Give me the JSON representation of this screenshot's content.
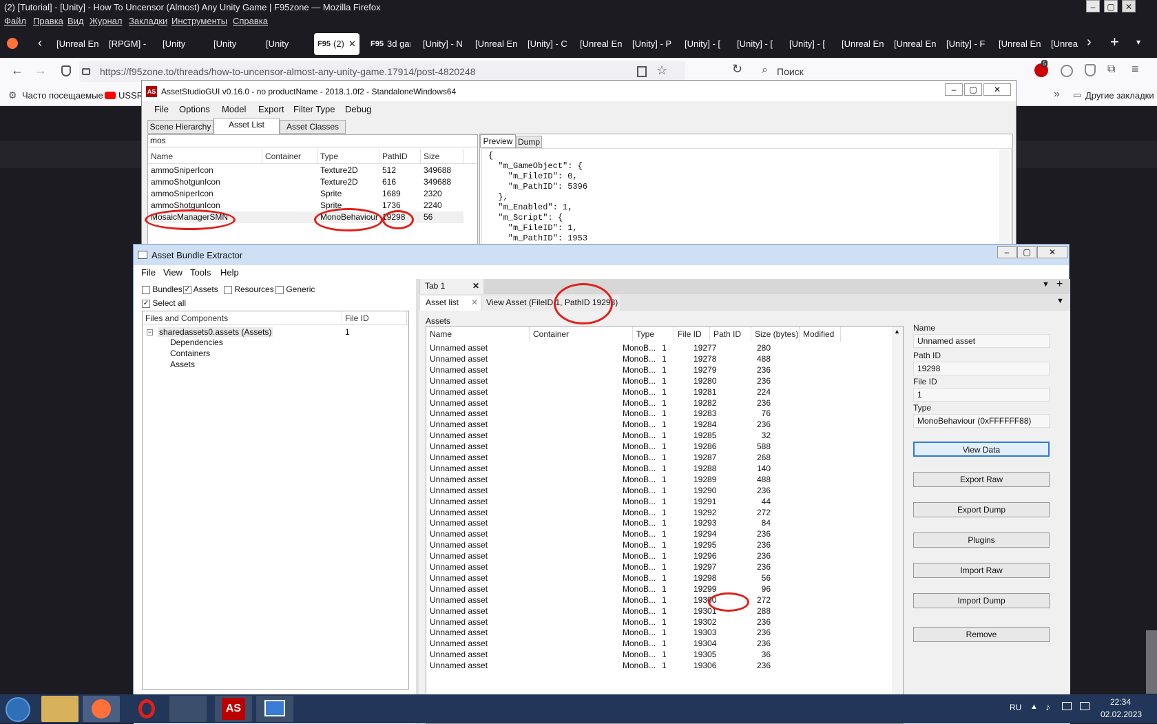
{
  "firefox": {
    "window_title": "(2) [Tutorial] - [Unity] - How To Uncensor (Almost) Any Unity Game | F95zone — Mozilla Firefox",
    "menu": [
      "Файл",
      "Правка",
      "Вид",
      "Журнал",
      "Закладки",
      "Инструменты",
      "Справка"
    ],
    "tabs": [
      "[Unreal En",
      "[RPGM] -",
      "[Unity",
      "[Unity",
      "[Unity",
      "(2)",
      "3d gar",
      "[Unity] - N",
      "[Unreal En",
      "[Unity] - C",
      "[Unreal En",
      "[Unity] - P",
      "[Unity] - [",
      "[Unity] - [",
      "[Unity] - [",
      "[Unreal En",
      "[Unreal En",
      "[Unity] - F",
      "[Unreal En",
      "[Unrea"
    ],
    "url": "https://f95zone.to/threads/how-to-uncensor-almost-any-unity-game.17914/post-4820248",
    "search_placeholder": "Поиск",
    "bookmarks": [
      "Часто посещаемые",
      "USSR"
    ],
    "other_bookmarks": "Другие закладки",
    "badge": "5",
    "window_controls": [
      "–",
      "▢",
      "✕"
    ],
    "tab_logo": "F95"
  },
  "assetstudio": {
    "title": "AssetStudioGUI v0.16.0 - no productName - 2018.1.0f2 - StandaloneWindows64",
    "logo": "AS",
    "menu": [
      "File",
      "Options",
      "Model",
      "Export",
      "Filter Type",
      "Debug"
    ],
    "tabs": [
      "Scene Hierarchy",
      "Asset List",
      "Asset Classes"
    ],
    "filter_text": "mos",
    "columns": [
      "Name",
      "Container",
      "Type",
      "PathID",
      "Size"
    ],
    "rows": [
      [
        "ammoSniperIcon",
        "",
        "Texture2D",
        "512",
        "349688"
      ],
      [
        "ammoShotgunIcon",
        "",
        "Texture2D",
        "616",
        "349688"
      ],
      [
        "ammoSniperIcon",
        "",
        "Sprite",
        "1689",
        "2320"
      ],
      [
        "ammoShotgunIcon",
        "",
        "Sprite",
        "1736",
        "2240"
      ],
      [
        "MosaicManagerSMN",
        "",
        "MonoBehaviour",
        "19298",
        "56"
      ]
    ],
    "preview_tabs": [
      "Preview",
      "Dump"
    ],
    "preview_json": "{\n  \"m_GameObject\": {\n    \"m_FileID\": 0,\n    \"m_PathID\": 5396\n  },\n  \"m_Enabled\": 1,\n  \"m_Script\": {\n    \"m_FileID\": 1,\n    \"m_PathID\": 1953\n  },"
  },
  "abe": {
    "title": "Asset Bundle Extractor",
    "menu": [
      "File",
      "View",
      "Tools",
      "Help"
    ],
    "filters": [
      {
        "label": "Bundles",
        "checked": false
      },
      {
        "label": "Assets",
        "checked": true
      },
      {
        "label": "Resources",
        "checked": false
      },
      {
        "label": "Generic",
        "checked": false
      }
    ],
    "select_all": "Select all",
    "tree_columns": [
      "Files and Components",
      "File ID"
    ],
    "tree": {
      "root": "sharedassets0.assets (Assets)",
      "root_id": "1",
      "children": [
        "Dependencies",
        "Containers",
        "Assets"
      ]
    },
    "doc_tab": "Tab 1",
    "sub_tabs": [
      "Asset list",
      "View Asset (FileID 1, PathID 19298)"
    ],
    "assets_label": "Assets",
    "grid_columns": [
      "Name",
      "Container",
      "Type",
      "File ID",
      "Path ID",
      "Size (bytes)",
      "Modified"
    ],
    "grid_rows": [
      [
        "Unnamed asset",
        "MonoB...",
        "1",
        "19277",
        "280"
      ],
      [
        "Unnamed asset",
        "MonoB...",
        "1",
        "19278",
        "488"
      ],
      [
        "Unnamed asset",
        "MonoB...",
        "1",
        "19279",
        "236"
      ],
      [
        "Unnamed asset",
        "MonoB...",
        "1",
        "19280",
        "236"
      ],
      [
        "Unnamed asset",
        "MonoB...",
        "1",
        "19281",
        "224"
      ],
      [
        "Unnamed asset",
        "MonoB...",
        "1",
        "19282",
        "236"
      ],
      [
        "Unnamed asset",
        "MonoB...",
        "1",
        "19283",
        "76"
      ],
      [
        "Unnamed asset",
        "MonoB...",
        "1",
        "19284",
        "236"
      ],
      [
        "Unnamed asset",
        "MonoB...",
        "1",
        "19285",
        "32"
      ],
      [
        "Unnamed asset",
        "MonoB...",
        "1",
        "19286",
        "588"
      ],
      [
        "Unnamed asset",
        "MonoB...",
        "1",
        "19287",
        "268"
      ],
      [
        "Unnamed asset",
        "MonoB...",
        "1",
        "19288",
        "140"
      ],
      [
        "Unnamed asset",
        "MonoB...",
        "1",
        "19289",
        "488"
      ],
      [
        "Unnamed asset",
        "MonoB...",
        "1",
        "19290",
        "236"
      ],
      [
        "Unnamed asset",
        "MonoB...",
        "1",
        "19291",
        "44"
      ],
      [
        "Unnamed asset",
        "MonoB...",
        "1",
        "19292",
        "272"
      ],
      [
        "Unnamed asset",
        "MonoB...",
        "1",
        "19293",
        "84"
      ],
      [
        "Unnamed asset",
        "MonoB...",
        "1",
        "19294",
        "236"
      ],
      [
        "Unnamed asset",
        "MonoB...",
        "1",
        "19295",
        "236"
      ],
      [
        "Unnamed asset",
        "MonoB...",
        "1",
        "19296",
        "236"
      ],
      [
        "Unnamed asset",
        "MonoB...",
        "1",
        "19297",
        "236"
      ],
      [
        "Unnamed asset",
        "MonoB...",
        "1",
        "19298",
        "56"
      ],
      [
        "Unnamed asset",
        "MonoB...",
        "1",
        "19299",
        "96"
      ],
      [
        "Unnamed asset",
        "MonoB...",
        "1",
        "19300",
        "272"
      ],
      [
        "Unnamed asset",
        "MonoB...",
        "1",
        "19301",
        "288"
      ],
      [
        "Unnamed asset",
        "MonoB...",
        "1",
        "19302",
        "236"
      ],
      [
        "Unnamed asset",
        "MonoB...",
        "1",
        "19303",
        "236"
      ],
      [
        "Unnamed asset",
        "MonoB...",
        "1",
        "19304",
        "236"
      ],
      [
        "Unnamed asset",
        "MonoB...",
        "1",
        "19305",
        "36"
      ],
      [
        "Unnamed asset",
        "MonoB...",
        "1",
        "19306",
        "236"
      ]
    ],
    "props": {
      "name_label": "Name",
      "name_value": "Unnamed asset",
      "pathid_label": "Path ID",
      "pathid_value": "19298",
      "fileid_label": "File ID",
      "fileid_value": "1",
      "type_label": "Type",
      "type_value": "MonoBehaviour (0xFFFFFF88)"
    },
    "buttons": [
      "View Data",
      "Export Raw",
      "Export Dump",
      "Plugins",
      "Import Raw",
      "Import Dump",
      "Remove"
    ]
  },
  "taskbar": {
    "lang": "RU",
    "time": "22:34",
    "date": "02.02.2023",
    "as_icon": "AS"
  },
  "colors": {
    "highlight_oval": "#e0201c",
    "taskbar": "#213658",
    "firefox_dark": "#1c1b22"
  }
}
